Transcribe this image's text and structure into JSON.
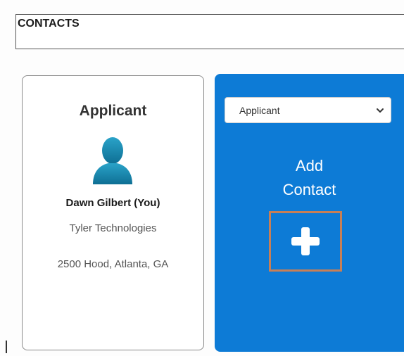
{
  "contacts": {
    "title": "CONTACTS"
  },
  "applicant_card": {
    "title": "Applicant",
    "avatar_icon": "person-silhouette-icon",
    "name": "Dawn Gilbert (You)",
    "company": "Tyler Technologies",
    "address": "2500 Hood, Atlanta, GA"
  },
  "add_contact": {
    "select_value": "Applicant",
    "chevron_icon": "chevron-down-icon",
    "label_line1": "Add",
    "label_line2": "Contact",
    "plus_icon": "plus-icon"
  },
  "colors": {
    "accent_blue": "#0d7bd6",
    "avatar_teal": "#1e8fb5",
    "highlight_frame": "#c77f56"
  }
}
